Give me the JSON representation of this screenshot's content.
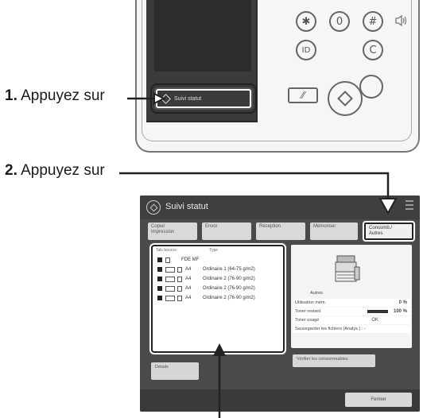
{
  "steps": [
    {
      "number": "1.",
      "text": "Appuyez sur"
    },
    {
      "number": "2.",
      "text": "Appuyez sur"
    }
  ],
  "device": {
    "status_button_label": "Suivi statut",
    "keys": [
      {
        "icon": "asterisk-key-icon",
        "glyph": "✱"
      },
      {
        "icon": "zero-key-icon",
        "glyph": "0"
      },
      {
        "icon": "hash-key-icon",
        "glyph": "#"
      },
      {
        "icon": "id-key-icon",
        "glyph": "ID"
      },
      {
        "icon": "clear-key-icon",
        "glyph": "C"
      }
    ],
    "volume_icon": "speaker-icon"
  },
  "screen": {
    "title": "Suivi statut",
    "tabs": [
      {
        "line1": "Copie/",
        "line2": "Impression"
      },
      {
        "line1": "Envoi",
        "line2": ""
      },
      {
        "line1": "Réception",
        "line2": ""
      },
      {
        "line1": "Mémoriser",
        "line2": ""
      },
      {
        "line1": "Consomb./",
        "line2": "Autres"
      }
    ],
    "active_tab": 4,
    "list": {
      "col1": "Tab./source",
      "col2": "Type",
      "rows": [
        {
          "size": "",
          "paper": "FDE MF"
        },
        {
          "size": "A4",
          "paper": "Ordinaire 1 (64-75 g/m2)"
        },
        {
          "size": "A4",
          "paper": "Ordinaire 2 (76-90 g/m2)"
        },
        {
          "size": "A4",
          "paper": "Ordinaire 2 (76-90 g/m2)"
        },
        {
          "size": "A4",
          "paper": "Ordinaire 2 (76-90 g/m2)"
        }
      ]
    },
    "info": {
      "section_label": "Autres",
      "rows": [
        {
          "label": "Utilisation mém.",
          "value": "0 %"
        },
        {
          "label": "Toner restant",
          "value": "100 %"
        },
        {
          "label": "Toner usagé",
          "value": "OK"
        },
        {
          "label": "Sauvegarder les fichiers (Analys.) : -",
          "value": ""
        }
      ],
      "check_button": "Vérifier les consommables"
    },
    "left_button": "Détails",
    "close_button": "Fermer"
  }
}
